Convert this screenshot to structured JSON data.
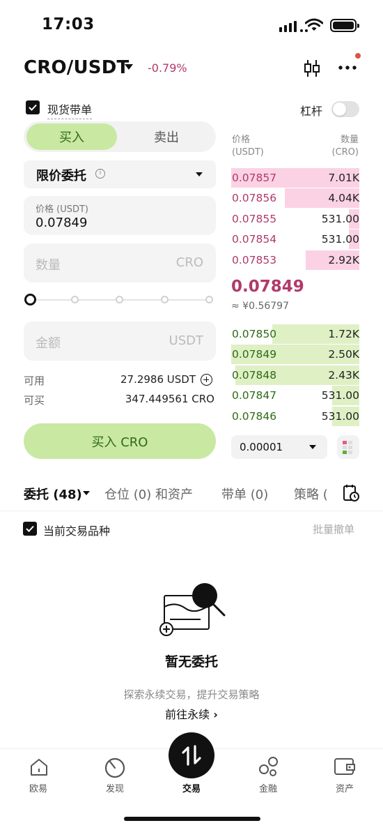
{
  "status_bar": {
    "time": "17:03"
  },
  "header": {
    "pair": "CRO/USDT",
    "change": "-0.79%"
  },
  "spot_option": {
    "label": "现货带单",
    "checked": true
  },
  "leverage": {
    "label": "杠杆",
    "enabled": false
  },
  "trade_tabs": {
    "buy": "买入",
    "sell": "卖出"
  },
  "order_type": {
    "label": "限价委托"
  },
  "price_field": {
    "label": "价格 (USDT)",
    "value": "0.07849"
  },
  "quantity_field": {
    "placeholder": "数量",
    "unit": "CRO"
  },
  "amount_field": {
    "placeholder": "金额",
    "unit": "USDT"
  },
  "balance": {
    "available_label": "可用",
    "available_value": "27.2986 USDT",
    "buyable_label": "可买",
    "buyable_value": "347.449561 CRO"
  },
  "buy_button": {
    "label": "买入 CRO"
  },
  "orderbook": {
    "price_header": "价格",
    "price_unit": "(USDT)",
    "qty_header": "数量",
    "qty_unit": "(CRO)",
    "asks": [
      {
        "price": "0.07857",
        "qty": "7.01K",
        "depth": 1.0
      },
      {
        "price": "0.07856",
        "qty": "4.04K",
        "depth": 0.58
      },
      {
        "price": "0.07855",
        "qty": "531.00",
        "depth": 0.08
      },
      {
        "price": "0.07854",
        "qty": "531.00",
        "depth": 0.08
      },
      {
        "price": "0.07853",
        "qty": "2.92K",
        "depth": 0.42
      }
    ],
    "last_price": "0.07849",
    "last_price_fiat": "≈ ¥0.56797",
    "bids": [
      {
        "price": "0.07850",
        "qty": "1.72K",
        "depth": 0.68
      },
      {
        "price": "0.07849",
        "qty": "2.50K",
        "depth": 1.0
      },
      {
        "price": "0.07848",
        "qty": "2.43K",
        "depth": 0.97
      },
      {
        "price": "0.07847",
        "qty": "531.00",
        "depth": 0.21
      },
      {
        "price": "0.07846",
        "qty": "531.00",
        "depth": 0.21
      }
    ],
    "tick_size": "0.00001"
  },
  "order_tabs": {
    "orders": "委托 (48)",
    "positions": "仓位 (0) 和资产",
    "copy": "带单 (0)",
    "strategy": "策略 ("
  },
  "current_pair_filter": {
    "label": "当前交易品种",
    "checked": true
  },
  "batch_cancel": "批量撤单",
  "empty_state": {
    "title": "暂无委托",
    "subtitle": "探索永续交易，提升交易策略",
    "link": "前往永续"
  },
  "bottom_nav": {
    "home": "欧易",
    "discover": "发现",
    "trade": "交易",
    "finance": "金融",
    "assets": "资产"
  },
  "colors": {
    "buy_green": "#c9e8a2",
    "buy_text": "#2f6b16",
    "sell_red": "#b0396a",
    "ask_bar": "#fbd2e4",
    "bid_bar": "#dff0c5"
  }
}
